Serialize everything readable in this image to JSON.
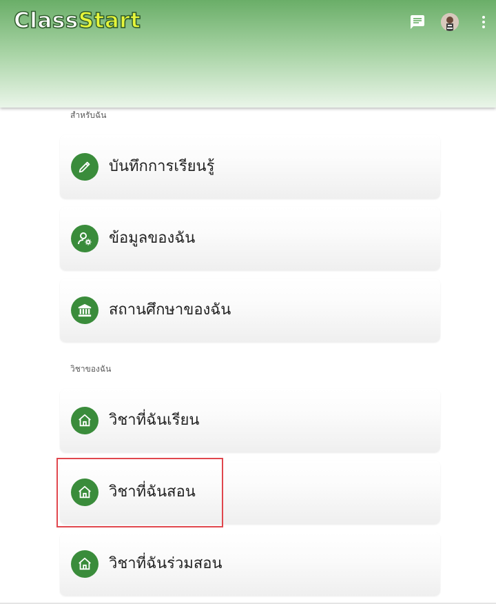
{
  "header": {
    "logo_part1": "Class",
    "logo_part2": "Start",
    "icons": [
      "chat-icon",
      "avatar",
      "more-vert-icon"
    ]
  },
  "sections": {
    "for_me_label": "สำหรับฉัน",
    "my_courses_label": "วิชาของฉัน"
  },
  "menu": {
    "learning_journal": {
      "label": "บันทึกการเรียนรู้",
      "icon": "pencil-icon"
    },
    "my_profile": {
      "label": "ข้อมูลของฉัน",
      "icon": "user-settings-icon"
    },
    "my_institution": {
      "label": "สถานศึกษาของฉัน",
      "icon": "institution-icon"
    },
    "courses_i_study": {
      "label": "วิชาที่ฉันเรียน",
      "icon": "home-icon"
    },
    "courses_i_teach": {
      "label": "วิชาที่ฉันสอน",
      "icon": "home-icon"
    },
    "courses_i_coteach": {
      "label": "วิชาที่ฉันร่วมสอน",
      "icon": "home-icon"
    }
  },
  "colors": {
    "accent_green": "#3a8c3b",
    "logo_yellow": "#e6f53a",
    "highlight_red": "#e0464d"
  }
}
